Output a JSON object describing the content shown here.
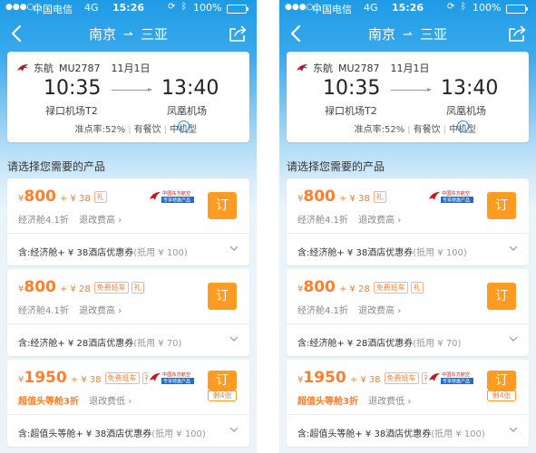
{
  "status_bar": {
    "signal": "●●●○○",
    "carrier": "中国电信",
    "network": "4G",
    "time": "15:26",
    "battery": "100%"
  },
  "nav": {
    "from": "南京",
    "to": "三亚",
    "arrow": "⇀"
  },
  "flight": {
    "airline": "东航",
    "flight_no": "MU2787",
    "date": "11月1日",
    "dep_time": "10:35",
    "arr_time": "13:40",
    "dep_airport": "禄口机场T2",
    "arr_airport": "凤凰机场",
    "on_time": "准点率:52%",
    "meal": "有餐饮",
    "aircraft": "中机型"
  },
  "section_title": "请选择您需要的产品",
  "products": [
    {
      "currency": "¥",
      "price": "800",
      "addon": "+ ¥ 38",
      "tags": [
        "礼"
      ],
      "cabin": "经济舱4.1折",
      "refund": "退改费高 ›",
      "book_label": "订",
      "remaining": "",
      "detail_prefix": "含:经济舱+ ¥ 38酒店优惠券",
      "detail_suffix": "(抵用 ¥ 100)",
      "has_partner_logo": true
    },
    {
      "currency": "¥",
      "price": "800",
      "addon": "+ ¥ 28",
      "tags": [
        "免费班车",
        "礼"
      ],
      "cabin": "经济舱4.1折",
      "refund": "退改费高 ›",
      "book_label": "订",
      "remaining": "",
      "detail_prefix": "含:经济舱+ ¥ 28酒店优惠券",
      "detail_suffix": "(抵用 ¥ 70)",
      "has_partner_logo": false
    },
    {
      "currency": "¥",
      "price": "1950",
      "addon": "+ ¥ 38",
      "tags": [
        "免费班车",
        "礼"
      ],
      "cabin": "超值头等舱3折",
      "refund": "退改费低 ›",
      "book_label": "订",
      "remaining": "剩4张",
      "detail_prefix": "含:超值头等舱+ ¥ 38酒店优惠券",
      "detail_suffix": "(抵用 ¥ 100)",
      "has_partner_logo": true
    }
  ],
  "partner": {
    "line1": "中国东方航空",
    "line2": "专享特惠产品"
  },
  "colors": {
    "accent": "#ff7e2b",
    "book_button": "#ff9b22",
    "header_blue": "#1e9be6"
  }
}
